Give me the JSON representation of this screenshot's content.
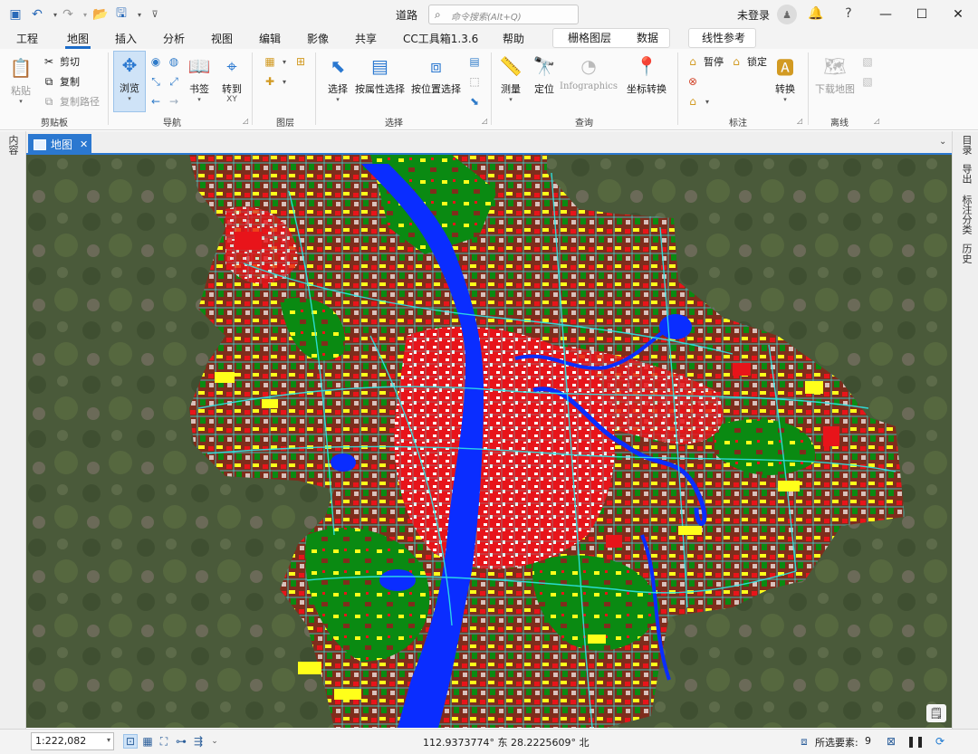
{
  "window": {
    "title": "道路",
    "search_placeholder": "命令搜索(Alt+Q)",
    "login_label": "未登录",
    "help": "?",
    "minimize": "—",
    "maximize": "☐",
    "close": "✕"
  },
  "menu": {
    "tabs": [
      "工程",
      "地图",
      "插入",
      "分析",
      "视图",
      "编辑",
      "影像",
      "共享",
      "CC工具箱1.3.6",
      "帮助"
    ],
    "active_tab": "地图",
    "context_tabs": [
      "栅格图层",
      "数据"
    ],
    "context_tab_extra": "线性参考"
  },
  "ribbon": {
    "clipboard": {
      "group": "剪贴板",
      "paste": "粘贴",
      "cut": "剪切",
      "copy": "复制",
      "copy_path": "复制路径"
    },
    "navigate": {
      "group": "导航",
      "explore": "浏览",
      "bookmarks": "书签",
      "goto": "转到",
      "goto_sub": "XY"
    },
    "layer": {
      "group": "图层"
    },
    "selection": {
      "group": "选择",
      "select": "选择",
      "by_attribute": "按属性选择",
      "by_location": "按位置选择"
    },
    "inquiry": {
      "group": "查询",
      "measure": "测量",
      "locate": "定位",
      "infographics": "Infographics",
      "convert_coords": "坐标转换"
    },
    "labeling": {
      "group": "标注",
      "pause": "暂停",
      "lock": "锁定",
      "convert": "转换"
    },
    "offline": {
      "group": "离线",
      "download_map": "下载地图"
    }
  },
  "left_pane": {
    "tab": "内容"
  },
  "right_pane": {
    "tabs": [
      "目录",
      "导出",
      "标注分类",
      "历史"
    ]
  },
  "map_view": {
    "tab_label": "地图",
    "tab_close": "✕"
  },
  "status": {
    "scale": "1:222,082",
    "coordinates": "112.9373774° 东 28.2225609° 北",
    "selected_label": "所选要素:",
    "selected_count": "9"
  },
  "map_legend_colors": {
    "water": "#0a2dff",
    "roads": "#2ee6e6",
    "residential": "#e8141a",
    "commercial": "#ffff1a",
    "forest": "#0a8a12",
    "farmland": "#7f2d1c",
    "satellite_base": "#4b5a3b"
  }
}
